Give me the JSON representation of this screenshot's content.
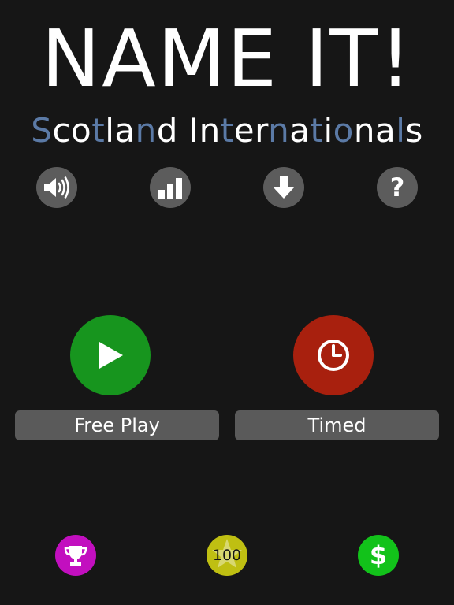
{
  "title": "NAME IT!",
  "subtitle": {
    "segments": [
      {
        "text": "S",
        "color": "blue"
      },
      {
        "text": "co",
        "color": "white"
      },
      {
        "text": "t",
        "color": "blue"
      },
      {
        "text": "la",
        "color": "white"
      },
      {
        "text": "n",
        "color": "blue"
      },
      {
        "text": "d",
        "color": "white"
      },
      {
        "text": " ",
        "color": "white"
      },
      {
        "text": "In",
        "color": "white"
      },
      {
        "text": "t",
        "color": "blue"
      },
      {
        "text": "er",
        "color": "white"
      },
      {
        "text": "n",
        "color": "blue"
      },
      {
        "text": "a",
        "color": "white"
      },
      {
        "text": "t",
        "color": "blue"
      },
      {
        "text": "i",
        "color": "white"
      },
      {
        "text": "o",
        "color": "blue"
      },
      {
        "text": "na",
        "color": "white"
      },
      {
        "text": "l",
        "color": "blue"
      },
      {
        "text": "s",
        "color": "white"
      }
    ]
  },
  "top_icons": [
    {
      "name": "speaker-icon"
    },
    {
      "name": "stats-bars-icon"
    },
    {
      "name": "download-arrow-icon"
    },
    {
      "name": "help-question-icon",
      "glyph": "?"
    }
  ],
  "modes": {
    "free_play_label": "Free Play",
    "timed_label": "Timed"
  },
  "bottom": {
    "hundred_label": "100",
    "dollar_label": "$"
  },
  "colors": {
    "background": "#161616",
    "icon_gray": "#5c5c5c",
    "label_bar": "#5a5a5a",
    "play_green": "#17951e",
    "timed_red": "#a8200e",
    "trophy_magenta": "#c20fbf",
    "hundred_yellow": "#bfbf12",
    "dollar_green": "#12c21a",
    "subtitle_blue": "#5b7aa6"
  }
}
